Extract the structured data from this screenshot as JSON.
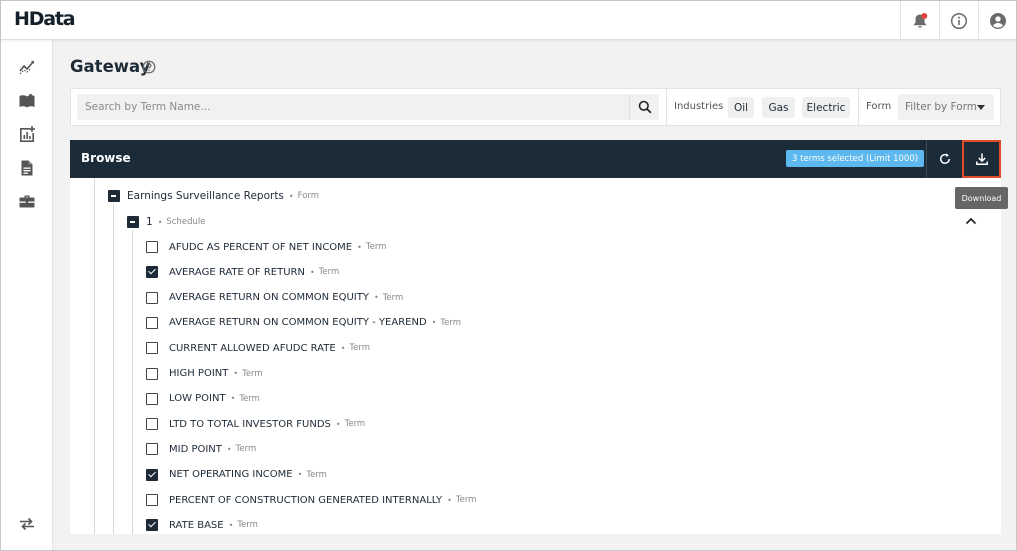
{
  "app": {
    "logo": "HData"
  },
  "header_icons": [
    "bell-icon",
    "info-icon",
    "account-icon"
  ],
  "sidebar": {
    "icons": [
      "trend-icon",
      "book-icon",
      "chart-add-icon",
      "document-icon",
      "briefcase-icon",
      "swap-icon"
    ]
  },
  "page": {
    "title": "Gateway"
  },
  "search": {
    "placeholder": "Search by Term Name..."
  },
  "filters": {
    "industries_label": "Industries",
    "industries": [
      "Oil",
      "Gas",
      "Electric"
    ],
    "form_label": "Form",
    "form_placeholder": "Filter by Form"
  },
  "browse": {
    "title": "Browse",
    "badge": "3 terms selected (Limit 1000)",
    "tooltip": "Download",
    "form": {
      "name": "Earnings Surveillance Reports",
      "type": "Form"
    },
    "schedule": {
      "name": "1",
      "type": "Schedule"
    },
    "terms": [
      {
        "name": "AFUDC AS PERCENT OF NET INCOME",
        "type": "Term",
        "checked": false
      },
      {
        "name": "AVERAGE RATE OF RETURN",
        "type": "Term",
        "checked": true
      },
      {
        "name": "AVERAGE RETURN ON COMMON EQUITY",
        "type": "Term",
        "checked": false
      },
      {
        "name": "AVERAGE RETURN ON COMMON EQUITY - YEAREND",
        "type": "Term",
        "checked": false
      },
      {
        "name": "CURRENT ALLOWED AFUDC RATE",
        "type": "Term",
        "checked": false
      },
      {
        "name": "HIGH POINT",
        "type": "Term",
        "checked": false
      },
      {
        "name": "LOW POINT",
        "type": "Term",
        "checked": false
      },
      {
        "name": "LTD TO TOTAL INVESTOR FUNDS",
        "type": "Term",
        "checked": false
      },
      {
        "name": "MID POINT",
        "type": "Term",
        "checked": false
      },
      {
        "name": "NET OPERATING INCOME",
        "type": "Term",
        "checked": true
      },
      {
        "name": "PERCENT OF CONSTRUCTION GENERATED INTERNALLY",
        "type": "Term",
        "checked": false
      },
      {
        "name": "RATE BASE",
        "type": "Term",
        "checked": true
      }
    ]
  },
  "colors": {
    "header_dark": "#1c2b38",
    "badge": "#5cb8ee",
    "highlight": "#e24c2c",
    "notification": "#e8453c"
  }
}
